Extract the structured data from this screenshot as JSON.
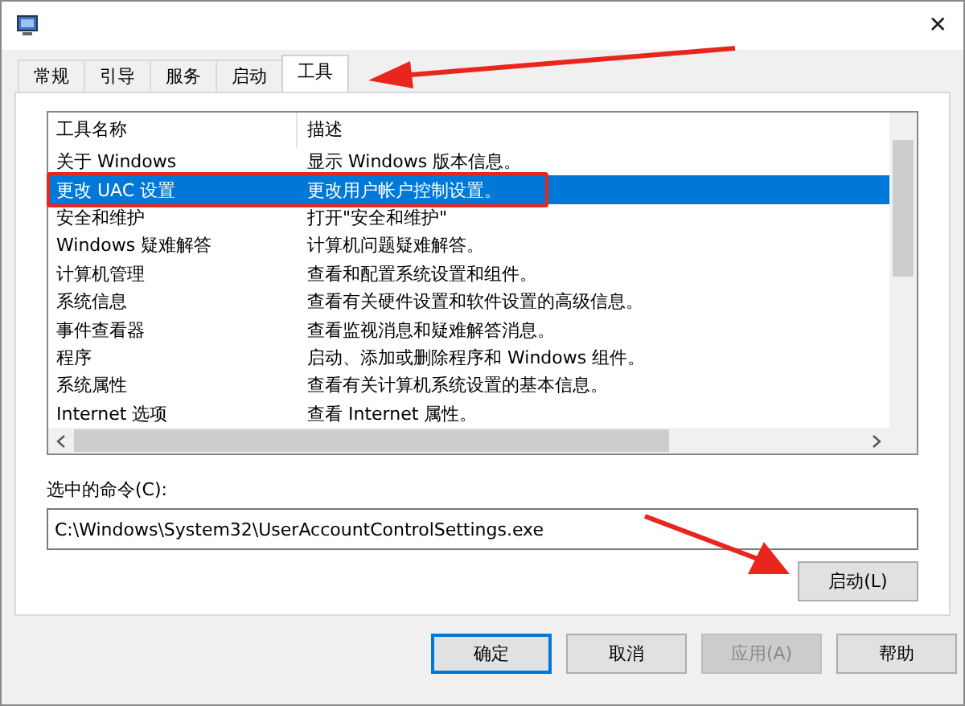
{
  "window": {
    "close": "✕"
  },
  "tabs": [
    {
      "label": "常规",
      "selected": false
    },
    {
      "label": "引导",
      "selected": false
    },
    {
      "label": "服务",
      "selected": false
    },
    {
      "label": "启动",
      "selected": false
    },
    {
      "label": "工具",
      "selected": true
    }
  ],
  "table": {
    "columns": [
      "工具名称",
      "描述"
    ],
    "rows": [
      {
        "name": "关于 Windows",
        "description": "显示 Windows 版本信息。",
        "selected": false
      },
      {
        "name": "更改 UAC 设置",
        "description": "更改用户帐户控制设置。",
        "selected": true
      },
      {
        "name": "安全和维护",
        "description": "打开\"安全和维护\"",
        "selected": false
      },
      {
        "name": "Windows 疑难解答",
        "description": "计算机问题疑难解答。",
        "selected": false
      },
      {
        "name": "计算机管理",
        "description": "查看和配置系统设置和组件。",
        "selected": false
      },
      {
        "name": "系统信息",
        "description": "查看有关硬件设置和软件设置的高级信息。",
        "selected": false
      },
      {
        "name": "事件查看器",
        "description": "查看监视消息和疑难解答消息。",
        "selected": false
      },
      {
        "name": "程序",
        "description": "启动、添加或删除程序和 Windows 组件。",
        "selected": false
      },
      {
        "name": "系统属性",
        "description": "查看有关计算机系统设置的基本信息。",
        "selected": false
      },
      {
        "name": "Internet 选项",
        "description": "查看 Internet 属性。",
        "selected": false
      }
    ]
  },
  "command": {
    "label": "选中的命令(C):",
    "value": "C:\\Windows\\System32\\UserAccountControlSettings.exe",
    "launch_button": "启动(L)"
  },
  "buttons": [
    {
      "label": "确定",
      "default": true,
      "disabled": false
    },
    {
      "label": "取消",
      "default": false,
      "disabled": false
    },
    {
      "label": "应用(A)",
      "default": false,
      "disabled": true
    },
    {
      "label": "帮助",
      "default": false,
      "disabled": false
    }
  ]
}
